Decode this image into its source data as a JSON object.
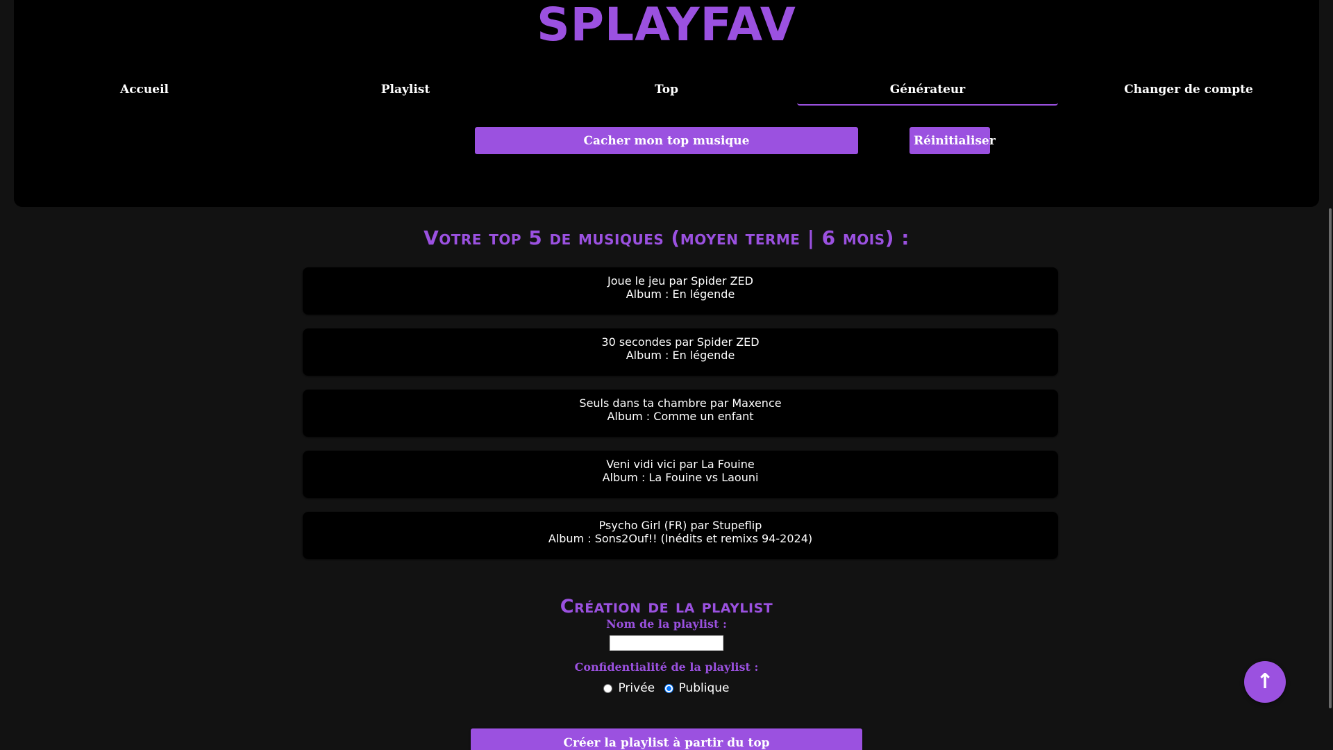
{
  "brand": "SPLAYFAV",
  "nav": {
    "items": [
      {
        "label": "Accueil"
      },
      {
        "label": "Playlist"
      },
      {
        "label": "Top"
      },
      {
        "label": "Générateur"
      },
      {
        "label": "Changer de compte"
      }
    ],
    "active": "Générateur"
  },
  "actions": {
    "hide_label": "Cacher mon top musique",
    "reset_label": "Réinitialiser"
  },
  "top": {
    "title": "Votre top 5 de musiques (moyen terme | 6 mois) :",
    "tracks": [
      {
        "title": "Joue le jeu par Spider ZED",
        "album": "Album : En légende"
      },
      {
        "title": "30 secondes par Spider ZED",
        "album": "Album : En légende"
      },
      {
        "title": "Seuls dans ta chambre par Maxence",
        "album": "Album : Comme un enfant"
      },
      {
        "title": "Veni vidi vici par La Fouine",
        "album": "Album : La Fouine vs Laouni"
      },
      {
        "title": "Psycho Girl (FR) par Stupeflip",
        "album": "Album : Sons2Ouf!! (Inédits et remixs 94-2024)"
      }
    ]
  },
  "creation": {
    "title": "Création de la playlist",
    "name_label": "Nom de la playlist :",
    "name_value": "",
    "privacy_label": "Confidentialité de la playlist :",
    "privacy_options": [
      {
        "label": "Privée",
        "checked": false
      },
      {
        "label": "Publique",
        "checked": true
      }
    ],
    "submit_label": "Créer la playlist à partir du top"
  },
  "scroll_top_icon": "arrow-up-icon",
  "colors": {
    "accent": "#9b51e0",
    "panel": "#000000",
    "background": "#121212"
  }
}
